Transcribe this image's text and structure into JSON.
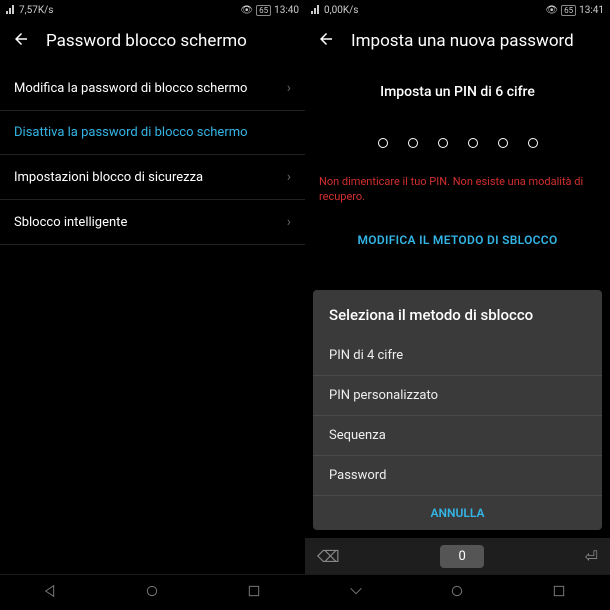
{
  "left": {
    "status": {
      "speed": "7,57K/s",
      "battery": "65",
      "time": "13:40"
    },
    "header": {
      "title": "Password blocco schermo"
    },
    "items": [
      {
        "label": "Modifica la password di blocco schermo",
        "highlight": false,
        "chevron": true
      },
      {
        "label": "Disattiva la password di blocco schermo",
        "highlight": true,
        "chevron": false
      },
      {
        "label": "Impostazioni blocco di sicurezza",
        "highlight": false,
        "chevron": true
      },
      {
        "label": "Sblocco intelligente",
        "highlight": false,
        "chevron": true
      }
    ]
  },
  "right": {
    "status": {
      "speed": "0,00K/s",
      "battery": "65",
      "time": "13:41"
    },
    "header": {
      "title": "Imposta una nuova password"
    },
    "pin_title": "Imposta un PIN di 6 cifre",
    "warning": "Non dimenticare il tuo PIN. Non esiste una modalità di recupero.",
    "change_method": "MODIFICA IL METODO DI SBLOCCO",
    "dialog": {
      "title": "Seleziona il metodo di sblocco",
      "options": [
        "PIN di 4 cifre",
        "PIN personalizzato",
        "Sequenza",
        "Password"
      ],
      "cancel": "ANNULLA"
    },
    "keyboard": {
      "zero_key": "0"
    }
  }
}
